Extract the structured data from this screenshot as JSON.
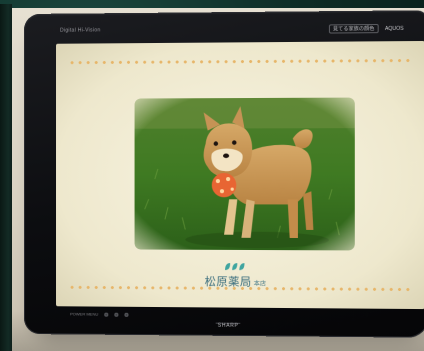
{
  "tv": {
    "top_left_label": "Digital Hi-Vision",
    "top_right_label": "見てる家族の顔色",
    "top_right_brand": "AQUOS",
    "bottom_brand": "SHARP",
    "bottom_controls": "POWER MENU"
  },
  "screen": {
    "logo_name": "松原薬局",
    "logo_branch": "本店",
    "logo_color": "#3a6e7e",
    "dot_color": "#e7b66a",
    "photo_subject": "shiba-inu-puppy-with-toy-ball"
  }
}
